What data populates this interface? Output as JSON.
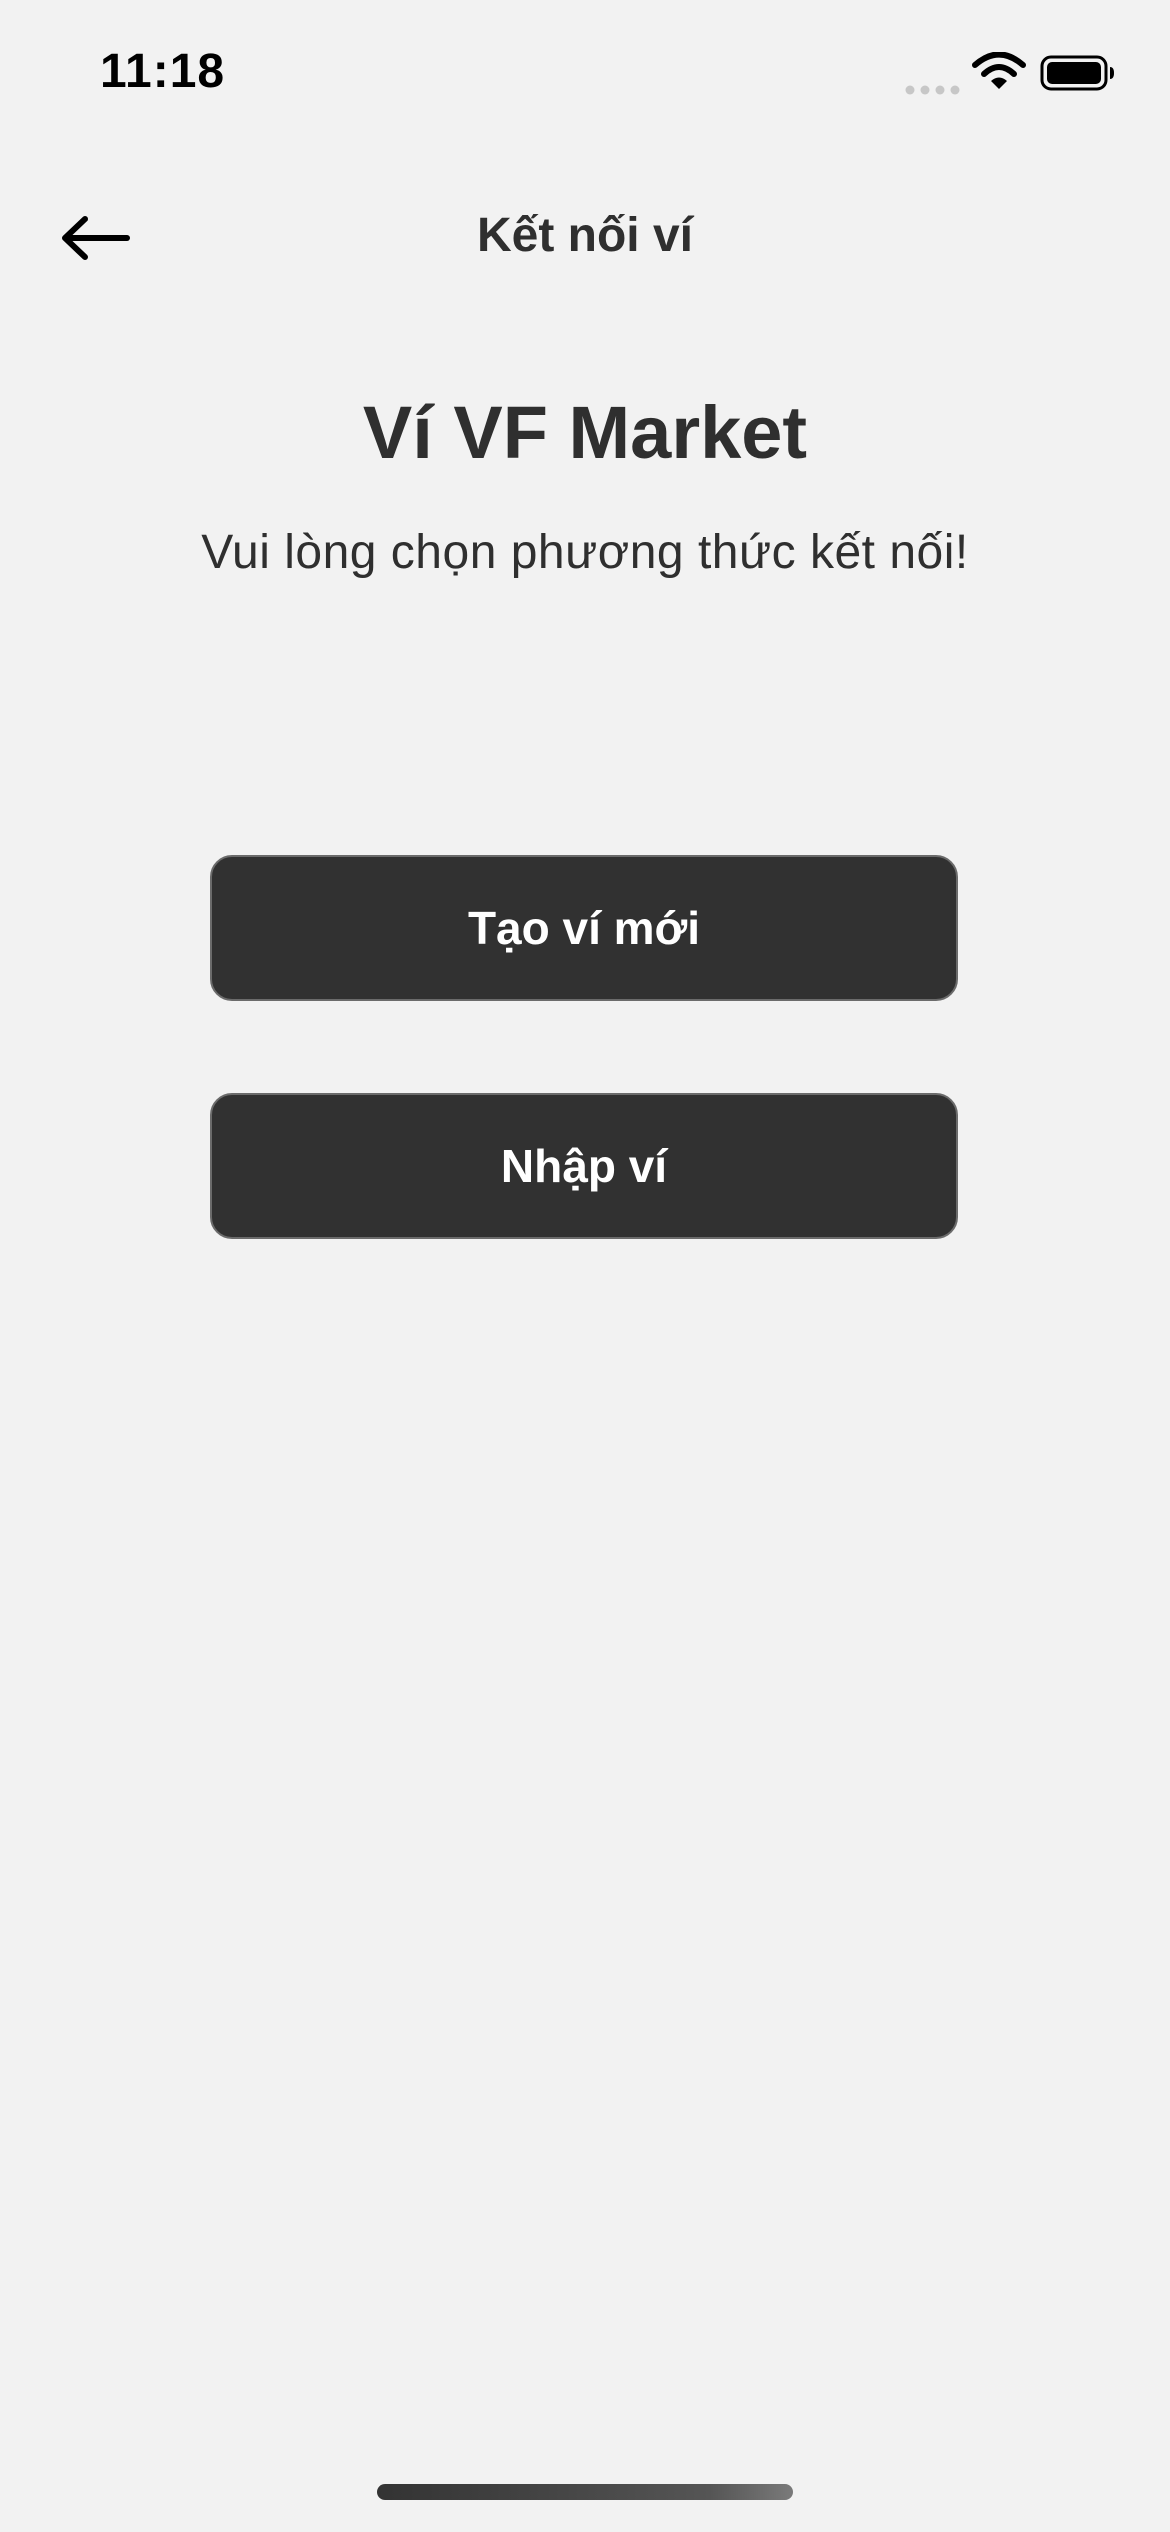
{
  "status_bar": {
    "time": "11:18",
    "signal_icon": "cellular-signal-icon",
    "wifi_icon": "wifi-icon",
    "battery_icon": "battery-icon"
  },
  "nav": {
    "back_icon": "arrow-left-icon",
    "title": "Kết nối ví"
  },
  "main": {
    "heading": "Ví VF Market",
    "subtitle": "Vui lòng chọn phương thức kết nối!",
    "create_wallet_label": "Tạo ví mới",
    "import_wallet_label": "Nhập ví"
  },
  "colors": {
    "background": "#f2f2f2",
    "button": "#313131",
    "button_text": "#ffffff",
    "text": "#2f2f2f"
  }
}
